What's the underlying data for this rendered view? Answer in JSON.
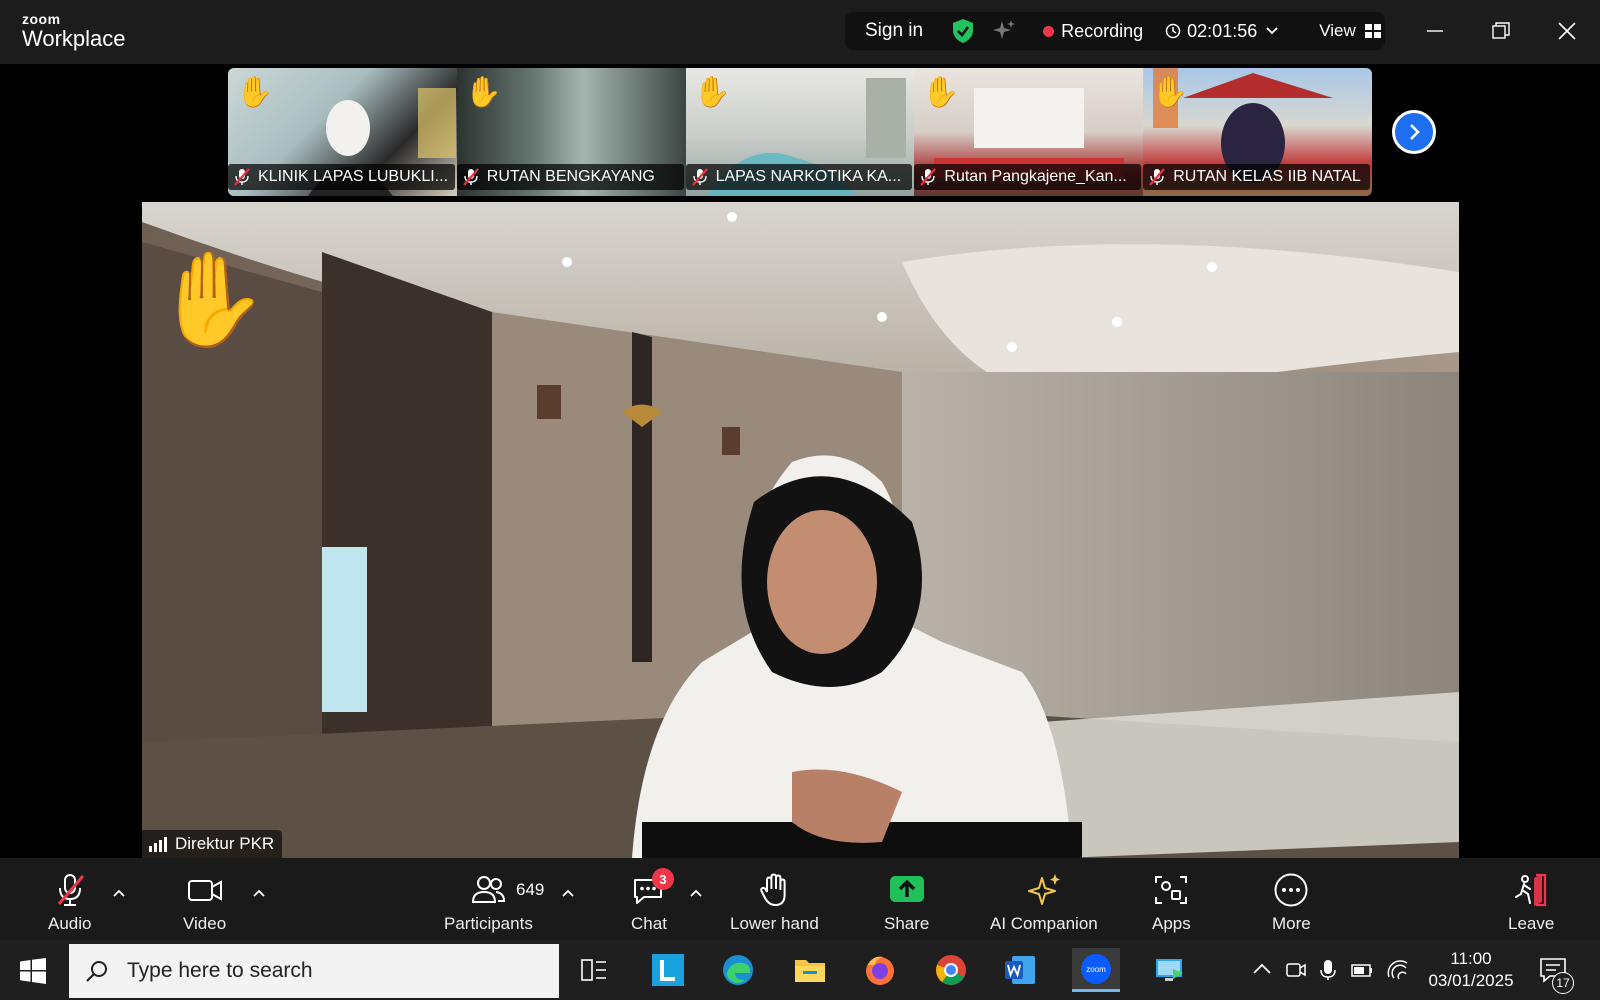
{
  "app": {
    "brand_small": "zoom",
    "brand_big": "Workplace"
  },
  "topbar": {
    "signin_label": "Sign in",
    "recording_label": "Recording",
    "timer": "02:01:56",
    "view_label": "View"
  },
  "thumbnails": [
    {
      "name": "KLINIK LAPAS LUBUKLI...",
      "hand": "✋"
    },
    {
      "name": "RUTAN BENGKAYANG",
      "hand": "✋"
    },
    {
      "name": "LAPAS NARKOTIKA KA...",
      "hand": "✋"
    },
    {
      "name": "Rutan Pangkajene_Kan...",
      "hand": "✋"
    },
    {
      "name": "RUTAN KELAS IIB NATAL",
      "hand": "✋"
    }
  ],
  "main_video": {
    "speaker_name": "Direktur PKR",
    "hand": "✋"
  },
  "toolbar": {
    "audio_label": "Audio",
    "video_label": "Video",
    "participants_label": "Participants",
    "participants_count": "649",
    "chat_label": "Chat",
    "chat_badge": "3",
    "lower_hand_label": "Lower hand",
    "share_label": "Share",
    "ai_companion_label": "AI Companion",
    "apps_label": "Apps",
    "more_label": "More",
    "leave_label": "Leave"
  },
  "taskbar": {
    "search_placeholder": "Type here to search",
    "time": "11:00",
    "date": "03/01/2025",
    "notification_count": "17",
    "apps": [
      "task-view",
      "l-app",
      "edge",
      "file-explorer",
      "firefox",
      "chrome",
      "word",
      "zoom",
      "remote-desktop"
    ]
  },
  "colors": {
    "accent_blue": "#1e6ff0",
    "record_red": "#f0364b",
    "share_green": "#20c05a",
    "shield_green": "#22c35e",
    "ai_yellow": "#f3c84a"
  }
}
